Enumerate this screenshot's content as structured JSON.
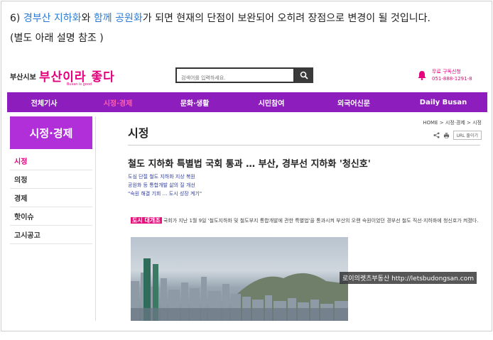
{
  "intro": {
    "prefix": "6) ",
    "hl1": "경부산 지하화",
    "mid1": "와 ",
    "hl2": "함께 공원화",
    "rest": "가 되면 현재의 단점이 보완되어 오히려 장점으로 변경이 될 것입니다.",
    "line2": "(별도 아래 설명 참조 )"
  },
  "site": {
    "brand_small": "부산시보",
    "brand_big": "부산이라 좋다",
    "brand_sub": "Busan is good",
    "search": {
      "placeholder": "검색어를 입력하세요."
    },
    "subscribe": {
      "line1": "무료 구독신청",
      "line2": "051-888-1291-8"
    }
  },
  "nav": {
    "items": [
      {
        "label": "전체기사"
      },
      {
        "label": "시정·경제"
      },
      {
        "label": "문화·생활"
      },
      {
        "label": "시민참여"
      },
      {
        "label": "외국어신문"
      },
      {
        "label": "Daily Busan"
      }
    ]
  },
  "sidebar": {
    "title": "시정·경제",
    "items": [
      {
        "label": "시정"
      },
      {
        "label": "의정"
      },
      {
        "label": "경제"
      },
      {
        "label": "핫이슈"
      },
      {
        "label": "고시공고"
      }
    ]
  },
  "main": {
    "heading": "시정",
    "breadcrumb": "HOME > 시정·경제 > 시정",
    "url_button": "URL 줄이기",
    "title": "철도 지하화 특별법 국회 통과 … 부산, 경부선 지하화 '청신호'",
    "subtitles": [
      "도심 단절 철도 지하화 지상 복원",
      "공원화 등 통합개발 삶의 질 개선",
      "\"숙원 해결 기회 … 도시 성장 계기\""
    ],
    "body_tag": "도시 대개조",
    "body_text": " 국회가 지난 1월 9일 '철도지하화 및 철도부지 통합개발에 관한 특별법'을 통과시켜 부산의 오랜 숙원이었던 경부선 철도 직선·지하화에 청신호가 켜졌다.",
    "watermark": "로이의렛츠부동산 http://letsbudongsan.com"
  },
  "colors": {
    "brand": "#e5007d",
    "nav_bg": "#8e1dbd",
    "sidebar_title_bg": "#b02fd8",
    "link": "#2b7bd6"
  }
}
